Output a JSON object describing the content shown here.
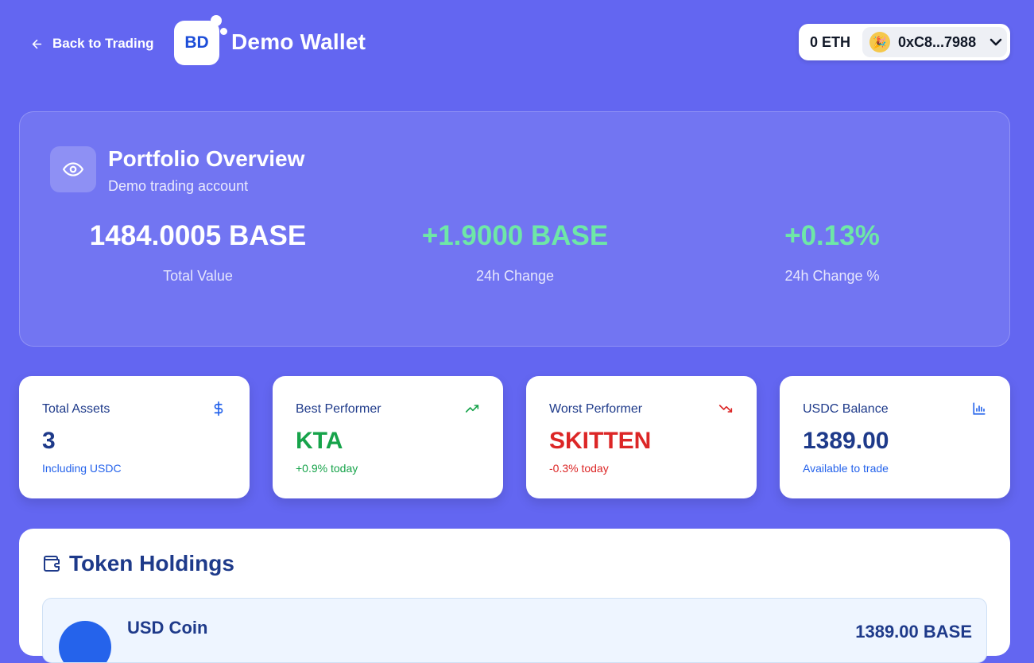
{
  "header": {
    "back_label": "Back to Trading",
    "logo_text": "BD",
    "app_title": "Demo Wallet",
    "eth_balance": "0 ETH",
    "wallet_address": "0xC8...7988",
    "avatar_emoji": "🎉"
  },
  "overview": {
    "title": "Portfolio Overview",
    "subtitle": "Demo trading account",
    "stats": [
      {
        "value": "1484.0005 BASE",
        "label": "Total Value"
      },
      {
        "value": "+1.9000 BASE",
        "label": "24h Change"
      },
      {
        "value": "+0.13%",
        "label": "24h Change %"
      }
    ]
  },
  "metrics": [
    {
      "title": "Total Assets",
      "value": "3",
      "sub": "Including USDC",
      "icon": "dollar-icon"
    },
    {
      "title": "Best Performer",
      "value": "KTA",
      "sub": "+0.9% today",
      "icon": "trending-up-icon"
    },
    {
      "title": "Worst Performer",
      "value": "SKITTEN",
      "sub": "-0.3% today",
      "icon": "trending-down-icon"
    },
    {
      "title": "USDC Balance",
      "value": "1389.00",
      "sub": "Available to trade",
      "icon": "bar-chart-icon"
    }
  ],
  "holdings": {
    "title": "Token Holdings",
    "tokens": [
      {
        "name": "USD Coin",
        "amount": "1389.00 BASE"
      }
    ]
  },
  "colors": {
    "background": "#6366f1",
    "positive": "#16a34a",
    "negative": "#dc2626",
    "accent": "#1e3a8a"
  }
}
